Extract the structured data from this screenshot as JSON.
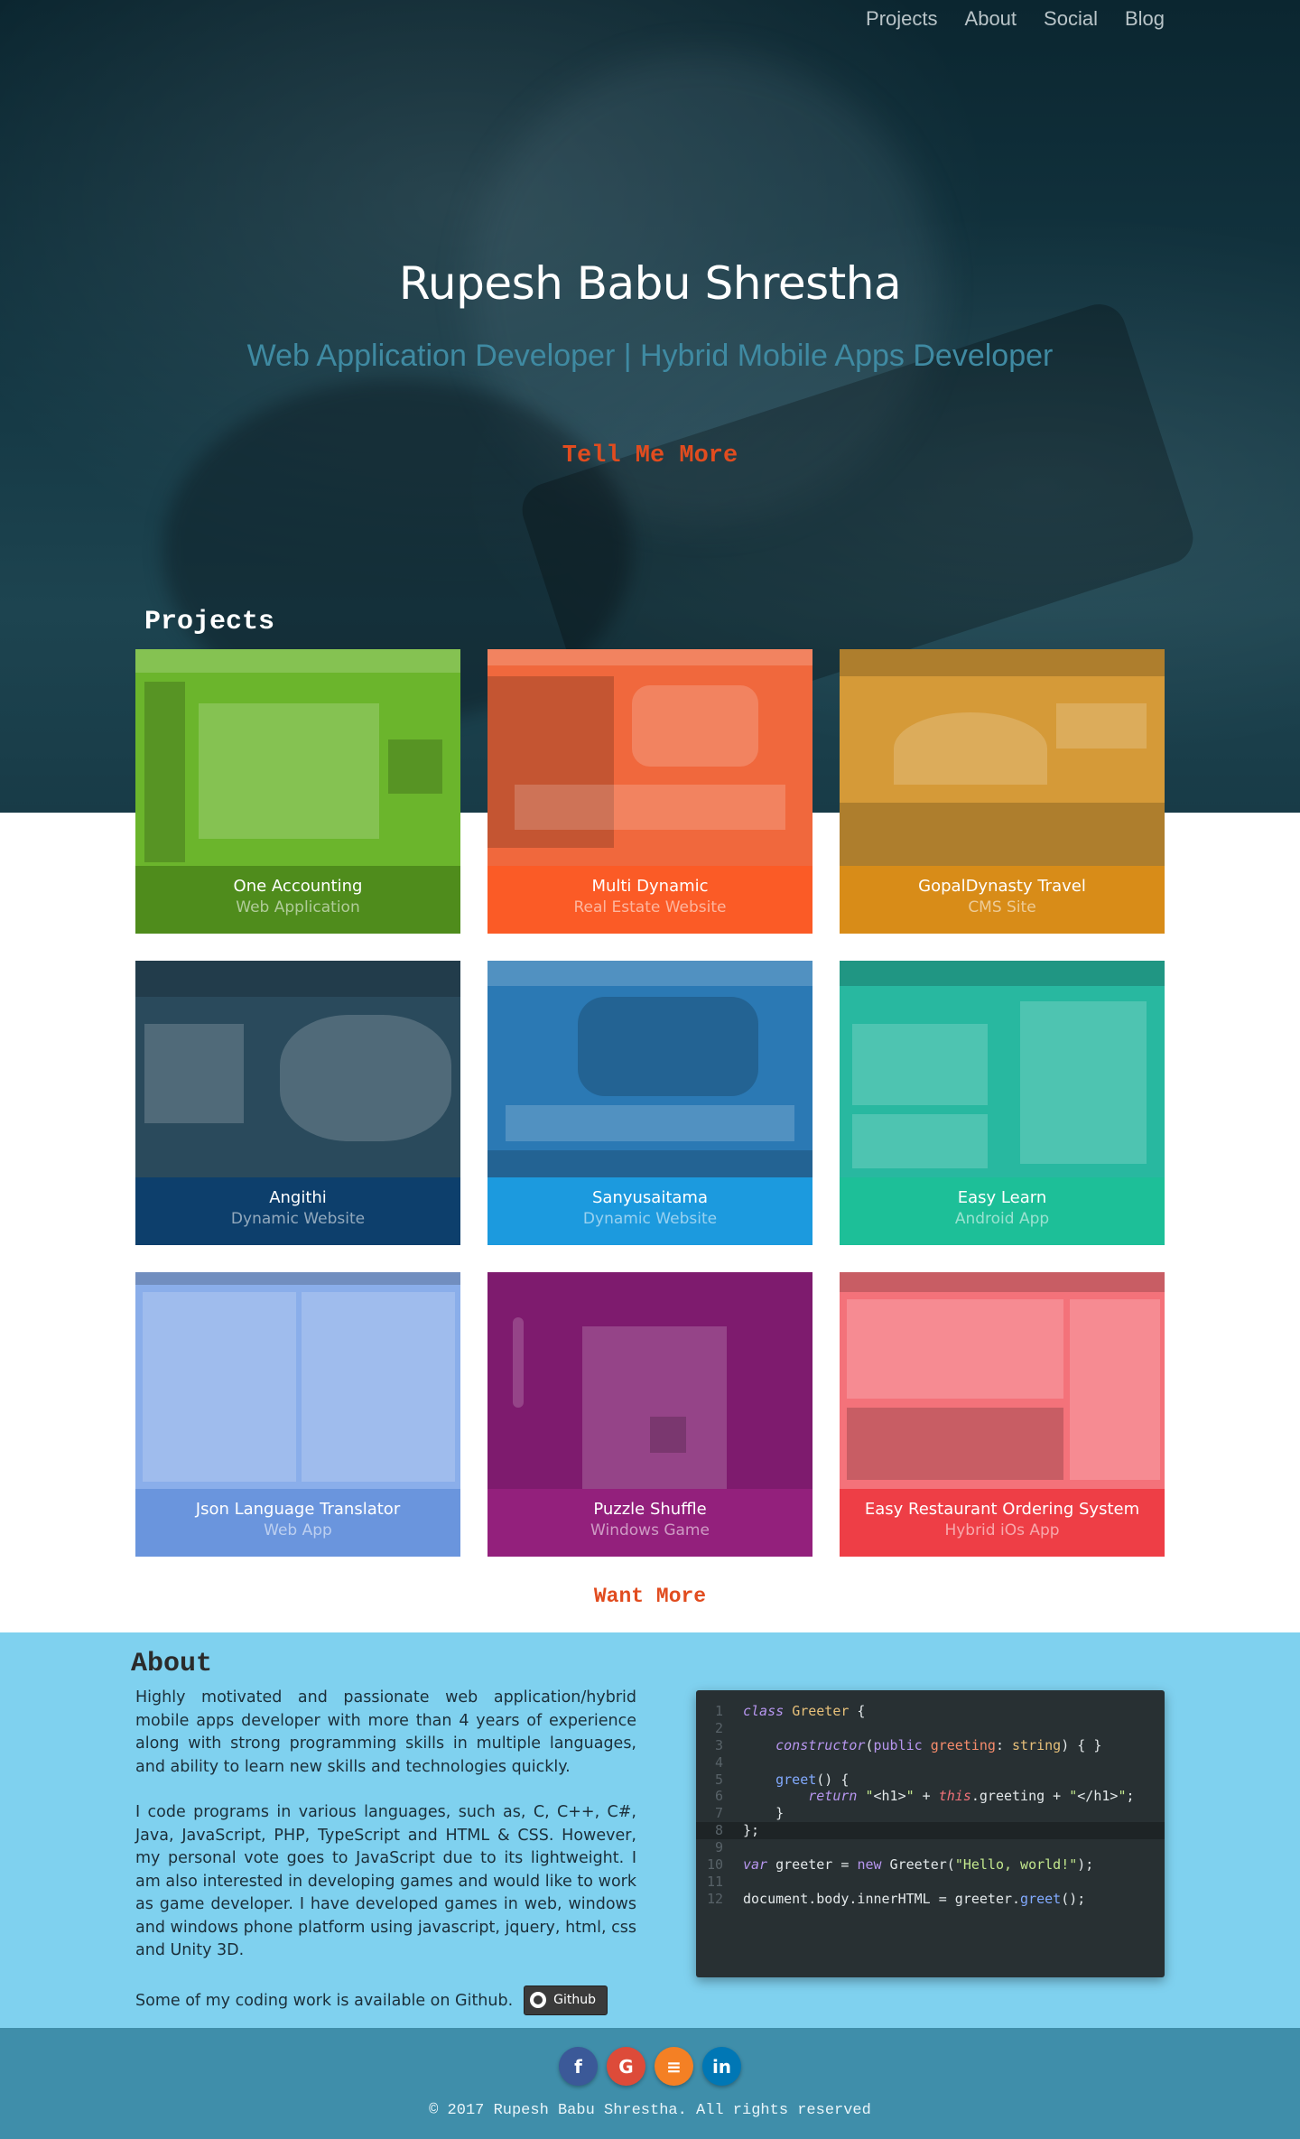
{
  "nav": {
    "items": [
      "Projects",
      "About",
      "Social",
      "Blog"
    ]
  },
  "hero": {
    "name": "Rupesh Babu Shrestha",
    "subtitle": "Web Application Developer | Hybrid Mobile Apps Developer",
    "cta": "Tell Me More"
  },
  "projects": {
    "title": "Projects",
    "items": [
      {
        "title": "One Accounting",
        "type": "Web Application",
        "color": "#4f8c1c"
      },
      {
        "title": "Multi Dynamic",
        "type": "Real Estate Website",
        "color": "#fb5b26"
      },
      {
        "title": "GopalDynasty Travel",
        "type": "CMS Site",
        "color": "#d88c18"
      },
      {
        "title": "Angithi",
        "type": "Dynamic Website",
        "color": "#0d3f6c"
      },
      {
        "title": "Sanyusaitama",
        "type": "Dynamic Website",
        "color": "#1c9ade"
      },
      {
        "title": "Easy Learn",
        "type": "Android App",
        "color": "#1dbf98"
      },
      {
        "title": "Json Language Translator",
        "type": "Web App",
        "color": "#6a95dd"
      },
      {
        "title": "Puzzle Shuffle",
        "type": "Windows Game",
        "color": "#93207c"
      },
      {
        "title": "Easy Restaurant Ordering System",
        "type": "Hybrid iOs App",
        "color": "#ee3e46"
      }
    ],
    "want_more": "Want More"
  },
  "about": {
    "title": "About",
    "p1": "Highly motivated and passionate web application/hybrid mobile apps developer with more than 4 years of experience along with strong programming skills in multiple languages, and ability to learn new skills and technologies quickly.",
    "p2": "I code programs in various languages, such as, C, C++, C#, Java, JavaScript, PHP, TypeScript and HTML & CSS. However, my personal vote goes to JavaScript due to its lightweight. I am also interested in developing games and would like to work as game developer. I have developed games in web, windows and windows phone platform using javascript, jquery, html, css and Unity 3D.",
    "p3": "Some of my coding work is available on Github.",
    "github_label": "Github"
  },
  "code": {
    "line_numbers": [
      "1",
      "2",
      "3",
      "4",
      "5",
      "6",
      "7",
      "8",
      "9",
      "10",
      "11",
      "12"
    ]
  },
  "footer": {
    "socials": [
      {
        "icon": "facebook-icon",
        "glyph": "f",
        "color": "#3b5998"
      },
      {
        "icon": "google-icon",
        "glyph": "G",
        "color": "#dd4b39"
      },
      {
        "icon": "stackoverflow-icon",
        "glyph": "≡",
        "color": "#f48024"
      },
      {
        "icon": "linkedin-icon",
        "glyph": "in",
        "color": "#0077b5"
      }
    ],
    "copyright": "© 2017 Rupesh Babu Shrestha. All rights reserved"
  }
}
